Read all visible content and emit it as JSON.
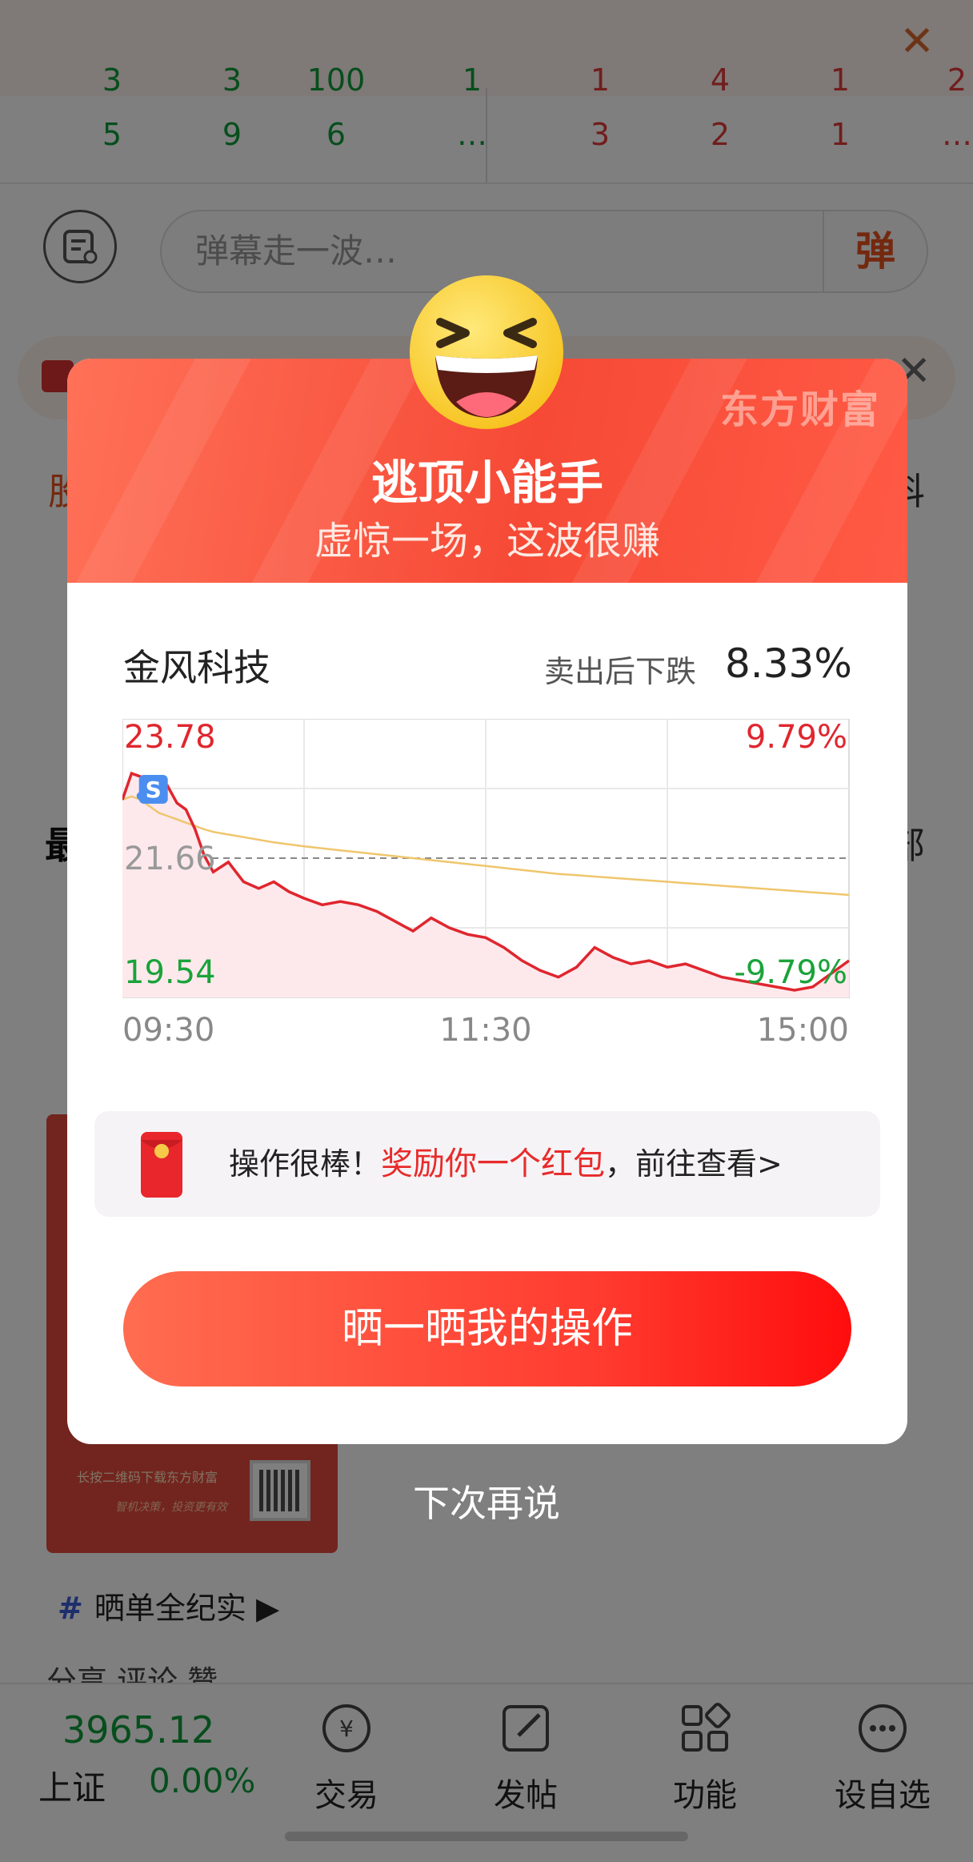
{
  "background": {
    "order_rows": [
      [
        "3",
        "3",
        "100",
        "1",
        "1",
        "4",
        "1",
        "2"
      ],
      [
        "5",
        "9",
        "6",
        "…",
        "3",
        "2",
        "1",
        "…"
      ]
    ],
    "danmu_placeholder": "弹幕走一波…",
    "danmu_send": "弹",
    "tab_left_fragment": "股",
    "tab_right_fragment": "科",
    "latest_fragment": "最",
    "latest_right_fragment": "部",
    "redbox_text": "长按二维码下载东方财富",
    "redbox_slogan": "智机决策，投资更有效",
    "hashtag": "晒单全纪实",
    "actions": "分享   评论   赞"
  },
  "bottom_nav": {
    "index_value": "3965.12",
    "index_name": "上证",
    "index_change": "0.00%",
    "items": [
      {
        "label": "交易",
        "icon": "trade-yen-icon"
      },
      {
        "label": "发帖",
        "icon": "post-edit-icon"
      },
      {
        "label": "功能",
        "icon": "grid-apps-icon"
      },
      {
        "label": "设自选",
        "icon": "more-dots-icon"
      }
    ]
  },
  "modal": {
    "brand": "东方财富",
    "badge_title": "逃顶小能手",
    "badge_subtitle": "虚惊一场，这波很赚",
    "stock_name": "金风科技",
    "drop_label": "卖出后下跌",
    "drop_value": "8.33%",
    "reward_prefix": "操作很棒！",
    "reward_highlight": "奖励你一个红包",
    "reward_suffix": "，前往查看>",
    "share_button": "晒一晒我的操作",
    "later": "下次再说"
  },
  "chart_data": {
    "type": "line",
    "y_high": "23.78",
    "y_mid": "21.66",
    "y_low": "19.54",
    "pct_high": "9.79%",
    "pct_low": "-9.79%",
    "x_labels": [
      "09:30",
      "11:30",
      "15:00"
    ],
    "sell_marker": "S",
    "ylim": [
      19.54,
      23.78
    ],
    "prev_close": 21.66,
    "x_minutes": [
      0,
      3,
      6,
      9,
      12,
      15,
      18,
      21,
      24,
      27,
      30,
      35,
      40,
      45,
      50,
      55,
      60,
      66,
      72,
      78,
      84,
      90,
      96,
      102,
      108,
      114,
      120,
      126,
      132,
      138,
      144,
      150,
      156,
      162,
      168,
      174,
      180,
      186,
      192,
      198,
      204,
      210,
      216,
      222,
      228,
      234,
      240
    ],
    "price": [
      22.55,
      22.95,
      22.9,
      22.85,
      22.6,
      22.75,
      22.5,
      22.4,
      22.1,
      21.7,
      21.45,
      21.6,
      21.3,
      21.2,
      21.3,
      21.15,
      21.05,
      20.95,
      21.0,
      20.95,
      20.85,
      20.7,
      20.55,
      20.75,
      20.6,
      20.5,
      20.45,
      20.3,
      20.1,
      19.95,
      19.85,
      20.0,
      20.3,
      20.15,
      20.05,
      20.1,
      20.0,
      20.05,
      19.95,
      19.85,
      19.8,
      19.75,
      19.7,
      19.65,
      19.7,
      19.9,
      20.1
    ],
    "avg_price": [
      22.55,
      22.6,
      22.55,
      22.45,
      22.35,
      22.3,
      22.25,
      22.2,
      22.15,
      22.1,
      22.06,
      22.02,
      21.98,
      21.94,
      21.9,
      21.87,
      21.84,
      21.81,
      21.78,
      21.75,
      21.72,
      21.69,
      21.66,
      21.63,
      21.6,
      21.57,
      21.54,
      21.51,
      21.48,
      21.45,
      21.42,
      21.4,
      21.38,
      21.36,
      21.34,
      21.32,
      21.3,
      21.28,
      21.26,
      21.24,
      21.22,
      21.2,
      21.18,
      21.16,
      21.14,
      21.12,
      21.1
    ],
    "sell_minute": 6
  }
}
